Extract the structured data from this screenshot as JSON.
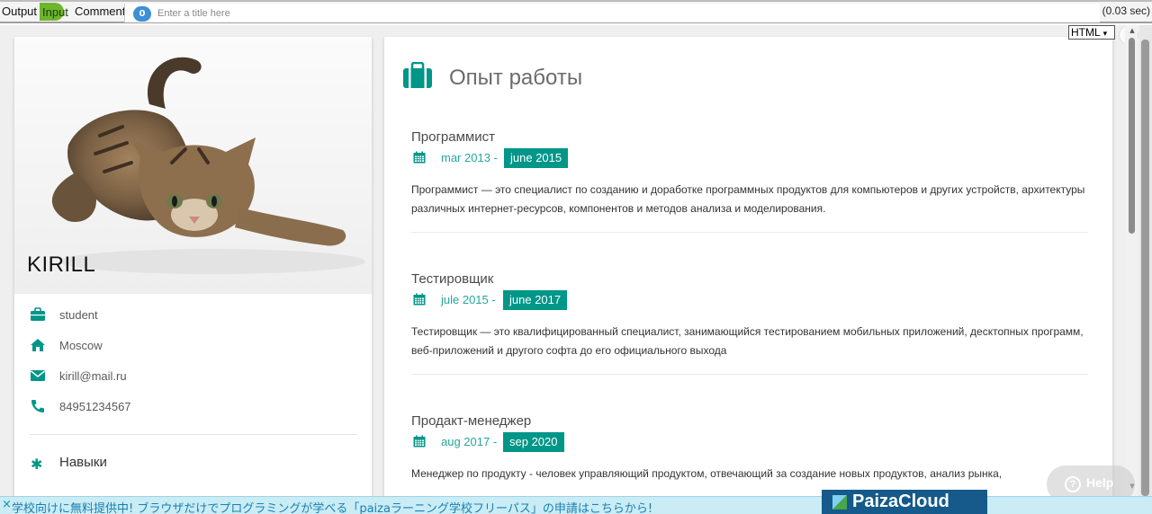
{
  "topbar": {
    "tabs": [
      "Output",
      "Input",
      "Comments"
    ],
    "comments_count": "0",
    "title_placeholder": "Enter a title here",
    "timing": "(0.03 sec)"
  },
  "frame": {
    "language": "HTML"
  },
  "profile": {
    "name": "KIRILL",
    "occupation": "student",
    "city": "Moscow",
    "email": "kirill@mail.ru",
    "phone": "84951234567",
    "skills_title": "Навыки"
  },
  "experience": {
    "title": "Опыт работы",
    "jobs": [
      {
        "title": "Программист",
        "from": "mar 2013 -",
        "to": "june 2015",
        "description": "Программист — это специалист по созданию и доработке программных продуктов для компьютеров и других устройств, архитектуры различных интернет-ресурсов, компонентов и методов анализа и моделирования."
      },
      {
        "title": "Тестировщик",
        "from": "jule 2015 -",
        "to": "june 2017",
        "description": "Тестировщик — это квалифицированный специалист, занимающийся тестированием мобильных приложений, десктопных программ, веб-приложений и другого софта до его официального выхода"
      },
      {
        "title": "Продакт-менеджер",
        "from": "aug 2017 -",
        "to": "sep 2020",
        "description": "Менеджер по продукту - человек управляющий продуктом, отвечающий за создание новых продуктов, анализ рынка,"
      }
    ]
  },
  "help_label": "Help",
  "banner": {
    "text": "学校向けに無料提供中! ブラウザだけでプログラミングが学べる「paizaラーニング学校フリーパス」の申請はこちらから!",
    "logo": "PaizaCloud",
    "accent_color": "#009688"
  }
}
